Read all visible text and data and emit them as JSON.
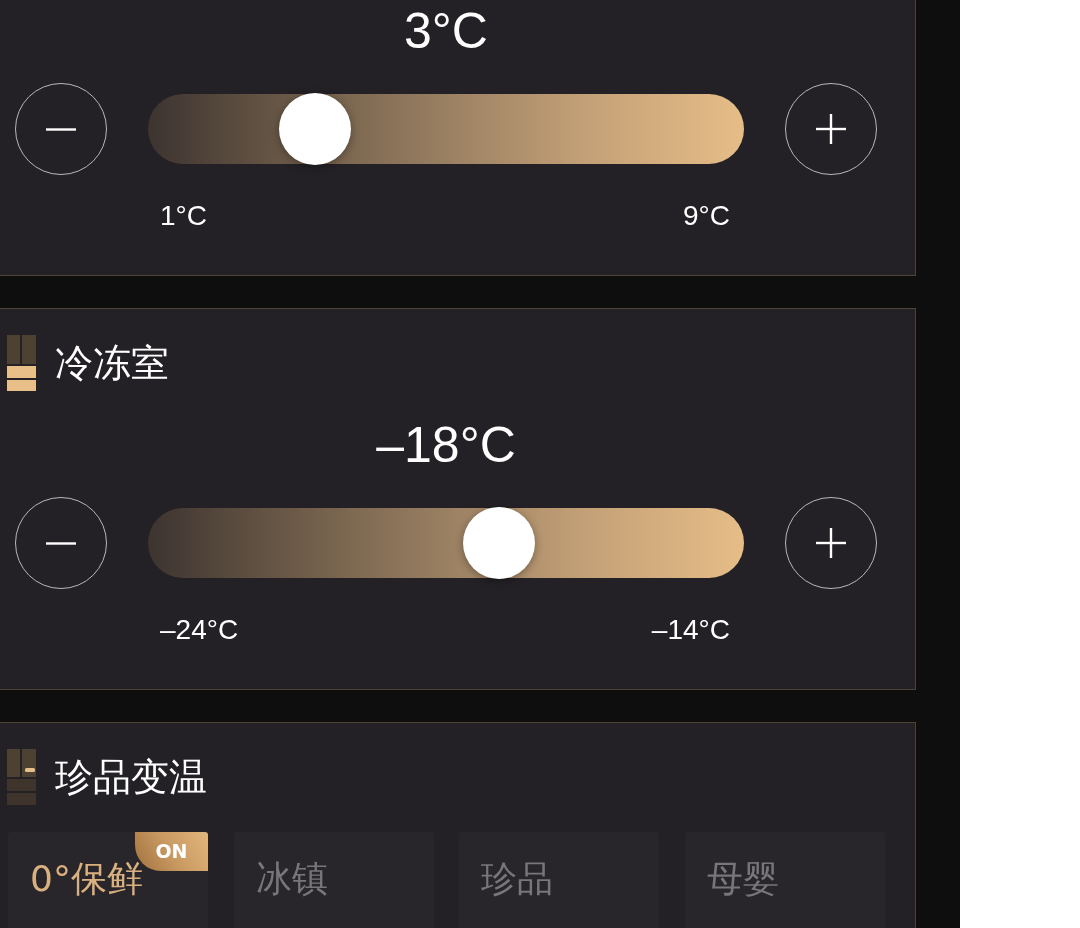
{
  "sections": [
    {
      "kind": "slider",
      "value": "3°C",
      "level": 0.25,
      "min_label": "1°C",
      "max_label": "9°C"
    },
    {
      "kind": "slider",
      "title": "冷冻室",
      "value": "–18°C",
      "level": 0.6,
      "min_label": "–24°C",
      "max_label": "–14°C"
    },
    {
      "kind": "modes",
      "title": "珍品变温",
      "modes": [
        {
          "label": "0°保鲜",
          "selected": true,
          "badge": "ON"
        },
        {
          "label": "冰镇",
          "selected": false
        },
        {
          "label": "珍品",
          "selected": false
        },
        {
          "label": "母婴",
          "selected": false
        }
      ]
    }
  ]
}
